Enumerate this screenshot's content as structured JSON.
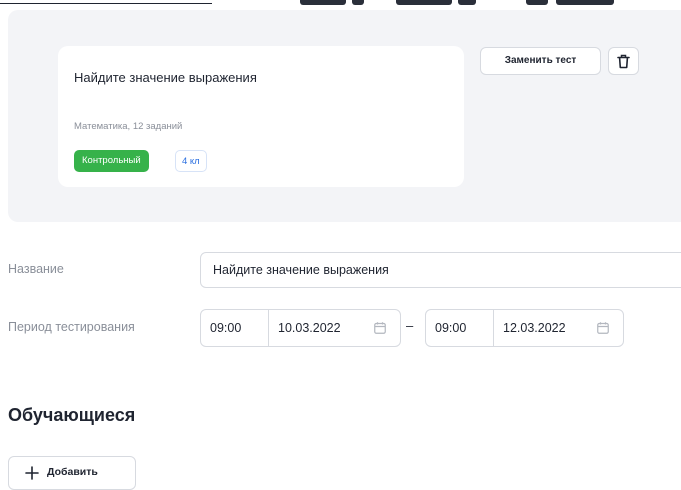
{
  "test_card": {
    "title": "Найдите значение выражения",
    "subtitle": "Математика, 12 заданий",
    "type_badge": "Контрольный",
    "grade_badge": "4 кл"
  },
  "actions": {
    "replace_label": "Заменить тест",
    "delete_icon": "trash-icon"
  },
  "form": {
    "name_label": "Название",
    "name_value": "Найдите значение выражения",
    "period_label": "Период тестирования",
    "start_time": "09:00",
    "start_date": "10.03.2022",
    "separator": "–",
    "end_time": "09:00",
    "end_date": "12.03.2022",
    "calendar_icon": "calendar-icon"
  },
  "students": {
    "title": "Обучающиеся",
    "add_label": "Добавить",
    "add_icon": "plus-icon"
  },
  "colors": {
    "panel_bg": "#f3f4f7",
    "badge_green": "#36b24a",
    "badge_blue_text": "#2a6fe0",
    "border": "#d7dae0",
    "muted_text": "#8a8f99"
  }
}
